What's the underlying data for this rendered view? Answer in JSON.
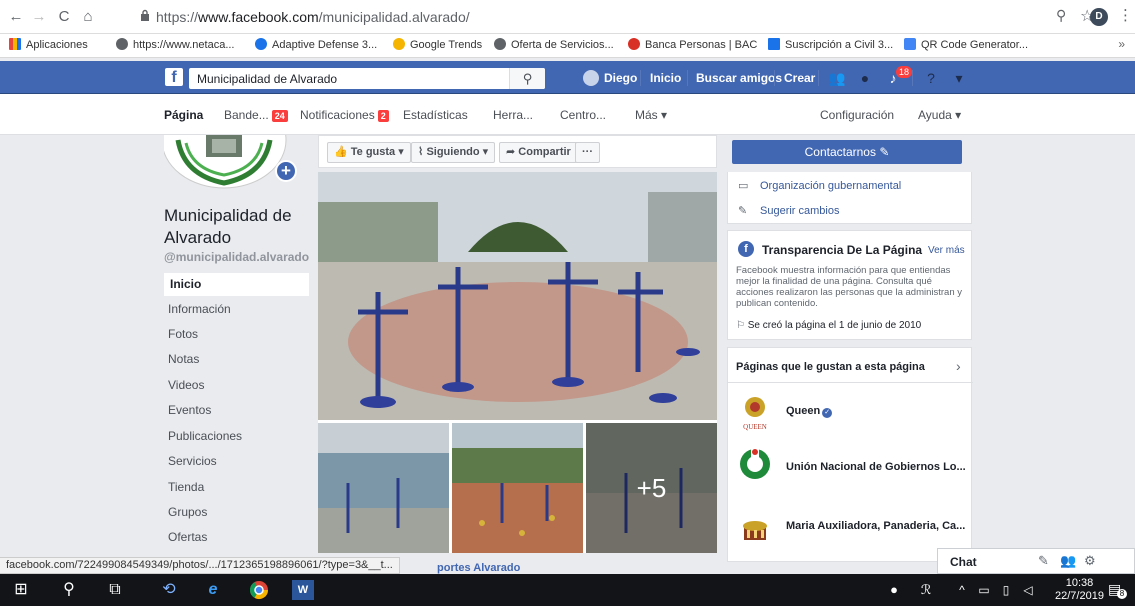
{
  "browser": {
    "url_prefix": "https://",
    "url_host": "www.facebook.com",
    "url_path": "/municipalidad.alvarado/",
    "profile_initial": "D"
  },
  "bookmarks": [
    {
      "label": "Aplicaciones",
      "color": "#e8453c"
    },
    {
      "label": "https://www.netaca...",
      "color": "#5f6368"
    },
    {
      "label": "Adaptive Defense 3...",
      "color": "#1a73e8"
    },
    {
      "label": "Google Trends",
      "color": "#f4b400"
    },
    {
      "label": "Oferta de Servicios...",
      "color": "#5f6368"
    },
    {
      "label": "Banca Personas | BAC",
      "color": "#d93025"
    },
    {
      "label": "Suscripción a Civil 3...",
      "color": "#1a73e8"
    },
    {
      "label": "QR Code Generator...",
      "color": "#4285f4"
    }
  ],
  "fb_bar": {
    "search_value": "Municipalidad de Alvarado",
    "user_name": "Diego",
    "home": "Inicio",
    "find_friends": "Buscar amigos",
    "create": "Crear",
    "notif_count": "18"
  },
  "page_tabs": [
    {
      "label": "Página",
      "active": true
    },
    {
      "label": "Bande...",
      "badge": "24"
    },
    {
      "label": "Notificaciones",
      "badge": "2"
    },
    {
      "label": "Estadísticas"
    },
    {
      "label": "Herra..."
    },
    {
      "label": "Centro..."
    },
    {
      "label": "Más ▾"
    },
    {
      "label": "Configuración"
    },
    {
      "label": "Ayuda ▾"
    }
  ],
  "page": {
    "name": "Municipalidad de Alvarado",
    "handle": "@municipalidad.alvarado"
  },
  "left_nav": [
    "Inicio",
    "Información",
    "Fotos",
    "Notas",
    "Videos",
    "Eventos",
    "Publicaciones",
    "Servicios",
    "Tienda",
    "Grupos",
    "Ofertas"
  ],
  "actions": {
    "like": "Te gusta ▾",
    "following": "Siguiendo ▾",
    "share": "Compartir",
    "more": "···"
  },
  "photos": {
    "more_count": "+5",
    "caption": "portes Alvarado"
  },
  "right": {
    "contact": "Contactarnos",
    "category": "Organización gubernamental",
    "suggest": "Sugerir cambios",
    "transparency_title": "Transparencia De La Página",
    "transparency_more": "Ver más",
    "transparency_desc": "Facebook muestra información para que entiendas mejor la finalidad de una página. Consulta qué acciones realizaron las personas que la administran y publican contenido.",
    "created": "Se creó la página el 1 de junio de 2010",
    "liked_title": "Páginas que le gustan a esta página",
    "liked_pages": [
      "Queen",
      "Unión Nacional de Gobiernos Lo...",
      "Maria Auxiliadora, Panaderia, Ca..."
    ]
  },
  "chat": {
    "label": "Chat"
  },
  "status_url": "facebook.com/722499084549349/photos/.../1712365198896061/?type=3&__t...",
  "taskbar": {
    "time": "10:38",
    "date": "22/7/2019",
    "notif": "8"
  }
}
